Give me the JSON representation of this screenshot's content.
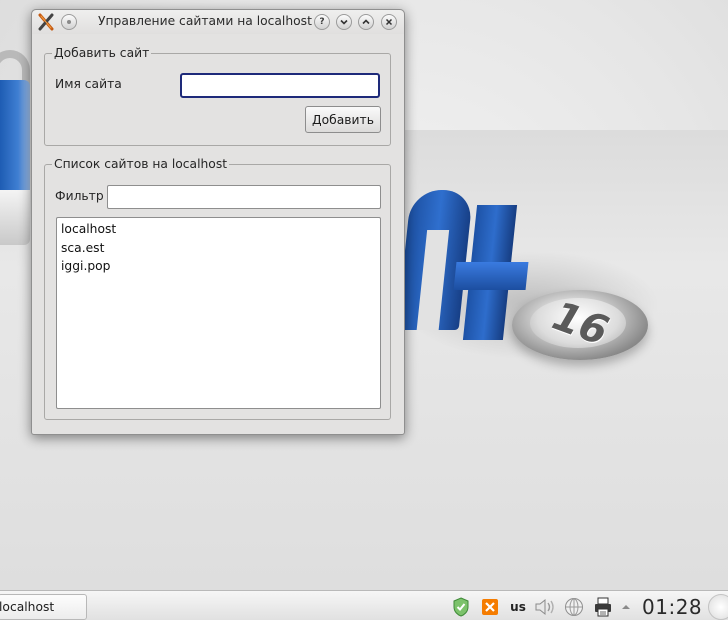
{
  "window": {
    "title": "Управление сайтами на localhost",
    "buttons": {
      "help": "?"
    }
  },
  "add_site": {
    "group_title": "Добавить сайт",
    "name_label": "Имя сайта",
    "name_value": "",
    "add_button_label": "Добавить"
  },
  "site_list": {
    "group_title": "Список сайтов на localhost",
    "filter_label": "Фильтр",
    "filter_value": "",
    "items": [
      "localhost",
      "sca.est",
      "iggi.pop"
    ]
  },
  "taskbar": {
    "task_label": "localhost",
    "keyboard_layout": "us",
    "clock": "01:28"
  },
  "wallpaper": {
    "badge_number": "16"
  },
  "icons": {
    "app": "xampp-x-icon",
    "window_menu": "window-menu-icon",
    "help": "help-icon",
    "minimize": "minimize-icon",
    "maximize": "maximize-icon",
    "close": "close-icon",
    "updates": "shield-check-icon",
    "xampp": "xampp-tray-icon",
    "volume": "volume-icon",
    "network": "network-icon",
    "printer": "printer-icon",
    "tray_expand": "chevron-up-icon"
  },
  "colors": {
    "window_bg": "#e3e2e1",
    "focus_border": "#1e2a7a",
    "mint_blue": "#2f6fce",
    "tray_green": "#4caf50",
    "xampp_orange": "#f57c00"
  }
}
